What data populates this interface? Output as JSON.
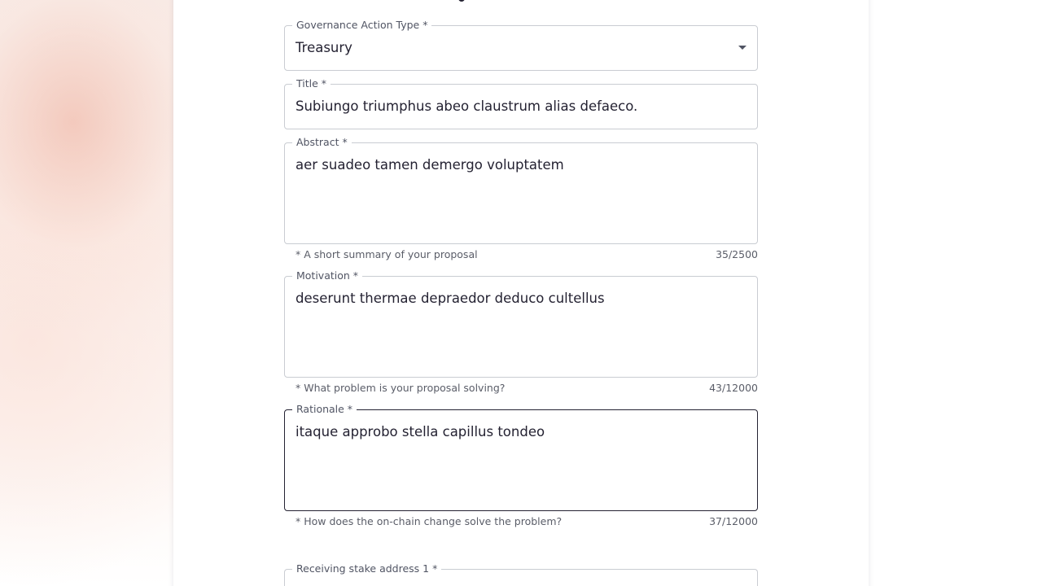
{
  "form": {
    "governance_action_type": {
      "label": "Governance Action Type *",
      "value": "Treasury"
    },
    "title": {
      "label": "Title *",
      "value": "Subiungo triumphus abeo claustrum alias defaeco."
    },
    "abstract": {
      "label": "Abstract *",
      "value": "aer suadeo tamen demergo voluptatem",
      "helper": "* A short summary of your proposal",
      "counter": "35/2500"
    },
    "motivation": {
      "label": "Motivation *",
      "value": "deserunt thermae depraedor deduco cultellus",
      "helper": "* What problem is your proposal solving?",
      "counter": "43/12000"
    },
    "rationale": {
      "label": "Rationale *",
      "value": "itaque approbo stella capillus tondeo",
      "helper": "* How does the on-chain change solve the problem?",
      "counter": "37/12000"
    },
    "receiving_stake_address": {
      "label": "Receiving stake address 1 *",
      "value": ""
    }
  },
  "colors": {
    "text_primary": "#242232",
    "border": "#c9ccd2",
    "border_focused": "#242232",
    "helper_text": "#5a5d68"
  },
  "icons": {
    "dropdown": "chevron-down-icon"
  }
}
